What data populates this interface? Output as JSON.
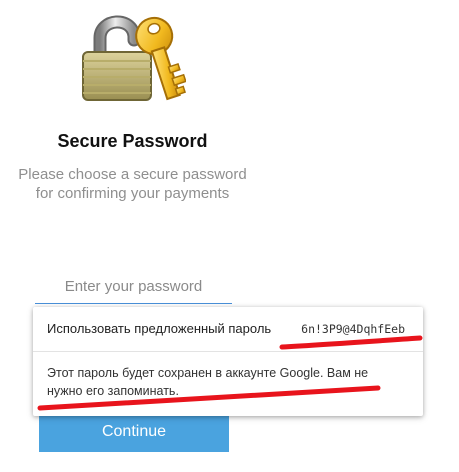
{
  "header": {
    "title": "Secure Password",
    "subtitle_line1": "Please choose a secure password",
    "subtitle_line2": "for confirming your payments"
  },
  "form": {
    "password_placeholder": "Enter your password",
    "continue_label": "Continue"
  },
  "password_suggestion": {
    "label": "Использовать предложенный пароль",
    "value": "6n!3P9@4DqhfEeb",
    "note": "Этот пароль будет сохранен в аккаунте Google. Вам не нужно его запоминать."
  },
  "icons": {
    "logo": "padlock-with-key-icon"
  },
  "colors": {
    "button": "#4aa3df",
    "input_underline": "#4a90d9",
    "annotation_marker": "#e8141c",
    "subtitle_text": "#8f8f8f"
  }
}
